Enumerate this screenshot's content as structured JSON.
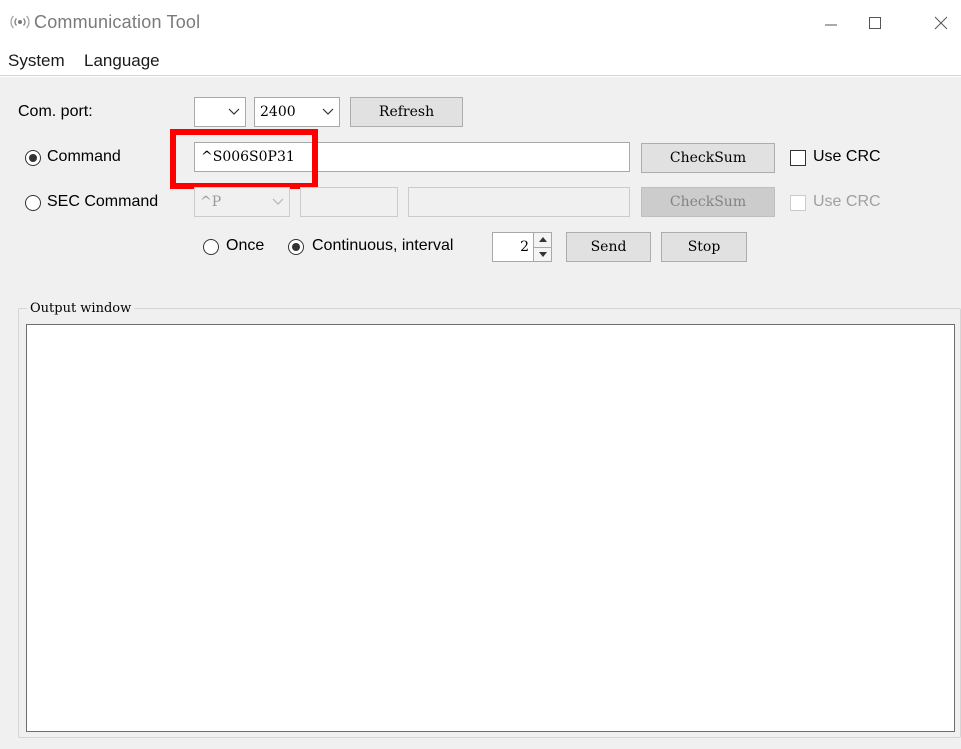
{
  "window": {
    "title": "Communication Tool",
    "icon": "signal-waves-icon",
    "controls": [
      "minimize-icon",
      "maximize-icon",
      "close-icon"
    ]
  },
  "menu": {
    "items": [
      "System",
      "Language"
    ]
  },
  "com_port": {
    "label": "Com. port:",
    "port_value": "",
    "baud_value": "2400",
    "refresh_label": "Refresh"
  },
  "command": {
    "radio_label": "Command",
    "selected": true,
    "value": "^S006S0P31",
    "checksum_label": "CheckSum",
    "crc_label": "Use CRC",
    "crc_checked": false
  },
  "sec_command": {
    "radio_label": "SEC Command",
    "selected": false,
    "prefix_value": "^P",
    "field1_value": "",
    "field2_value": "",
    "checksum_label": "CheckSum",
    "crc_label": "Use CRC",
    "crc_checked": false
  },
  "send_mode": {
    "once_label": "Once",
    "continuous_label": "Continuous, interval",
    "mode": "continuous",
    "interval": "2",
    "send_label": "Send",
    "stop_label": "Stop"
  },
  "output": {
    "label": "Output window",
    "content": ""
  },
  "colors": {
    "highlight": "#ff0000",
    "client_bg": "#f0f0f0",
    "button_bg": "#e1e1e1"
  }
}
